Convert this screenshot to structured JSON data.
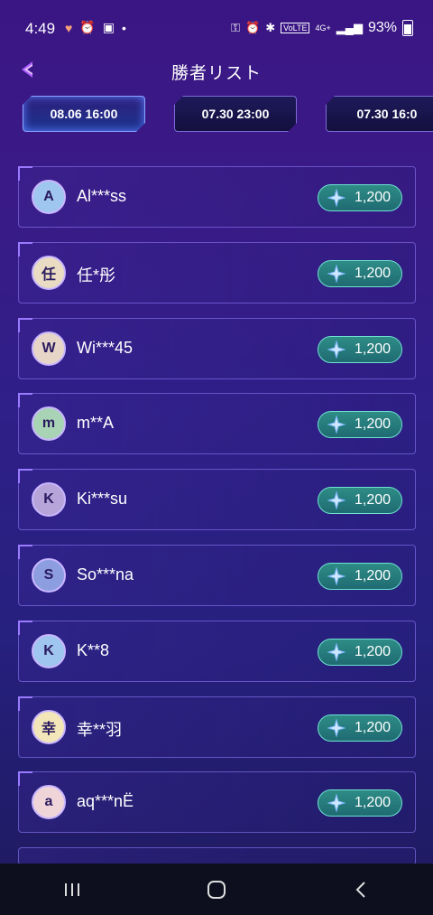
{
  "status_bar": {
    "time": "4:49",
    "battery_pct": "93%"
  },
  "header": {
    "title": "勝者リスト"
  },
  "tabs": [
    {
      "label": "08.06 16:00",
      "active": true
    },
    {
      "label": "07.30 23:00",
      "active": false
    },
    {
      "label": "07.30 16:0",
      "active": false
    }
  ],
  "winners": [
    {
      "name": "Al***ss",
      "amount": "1,200",
      "avatar_color": "#9fc6ef",
      "initial": "A"
    },
    {
      "name": "任*彤",
      "amount": "1,200",
      "avatar_color": "#e9dcc2",
      "initial": "任"
    },
    {
      "name": "Wi***45",
      "amount": "1,200",
      "avatar_color": "#e7d6c7",
      "initial": "W"
    },
    {
      "name": "m**A",
      "amount": "1,200",
      "avatar_color": "#a8d4b5",
      "initial": "m"
    },
    {
      "name": "Ki***su",
      "amount": "1,200",
      "avatar_color": "#b7a5d9",
      "initial": "K"
    },
    {
      "name": "So***na",
      "amount": "1,200",
      "avatar_color": "#8d9ee0",
      "initial": "S"
    },
    {
      "name": "K**8",
      "amount": "1,200",
      "avatar_color": "#9fc6ef",
      "initial": "K"
    },
    {
      "name": "幸**羽",
      "amount": "1,200",
      "avatar_color": "#f3e6b8",
      "initial": "幸"
    },
    {
      "name": "aq***nË",
      "amount": "1,200",
      "avatar_color": "#f0d5d8",
      "initial": "a"
    }
  ],
  "icons": {
    "back": "back-arrow-icon",
    "gem": "primogem-icon"
  }
}
